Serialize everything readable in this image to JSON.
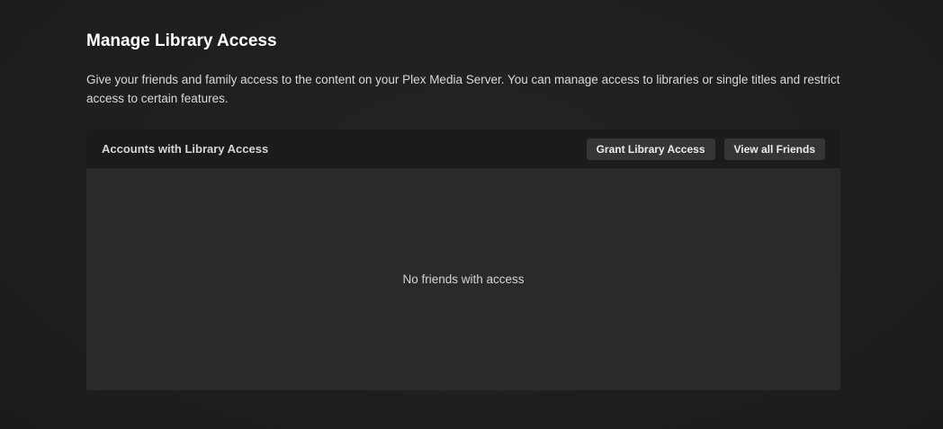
{
  "header": {
    "title": "Manage Library Access",
    "description": "Give your friends and family access to the content on your Plex Media Server. You can manage access to libraries or single titles and restrict access to certain features."
  },
  "panel": {
    "title": "Accounts with Library Access",
    "grant_button_label": "Grant Library Access",
    "view_friends_button_label": "View all Friends",
    "empty_message": "No friends with access"
  },
  "colors": {
    "background": "#1f1f1f",
    "panel_header": "#1b1b1b",
    "panel_body": "#2a2a2a",
    "button": "#353535"
  }
}
